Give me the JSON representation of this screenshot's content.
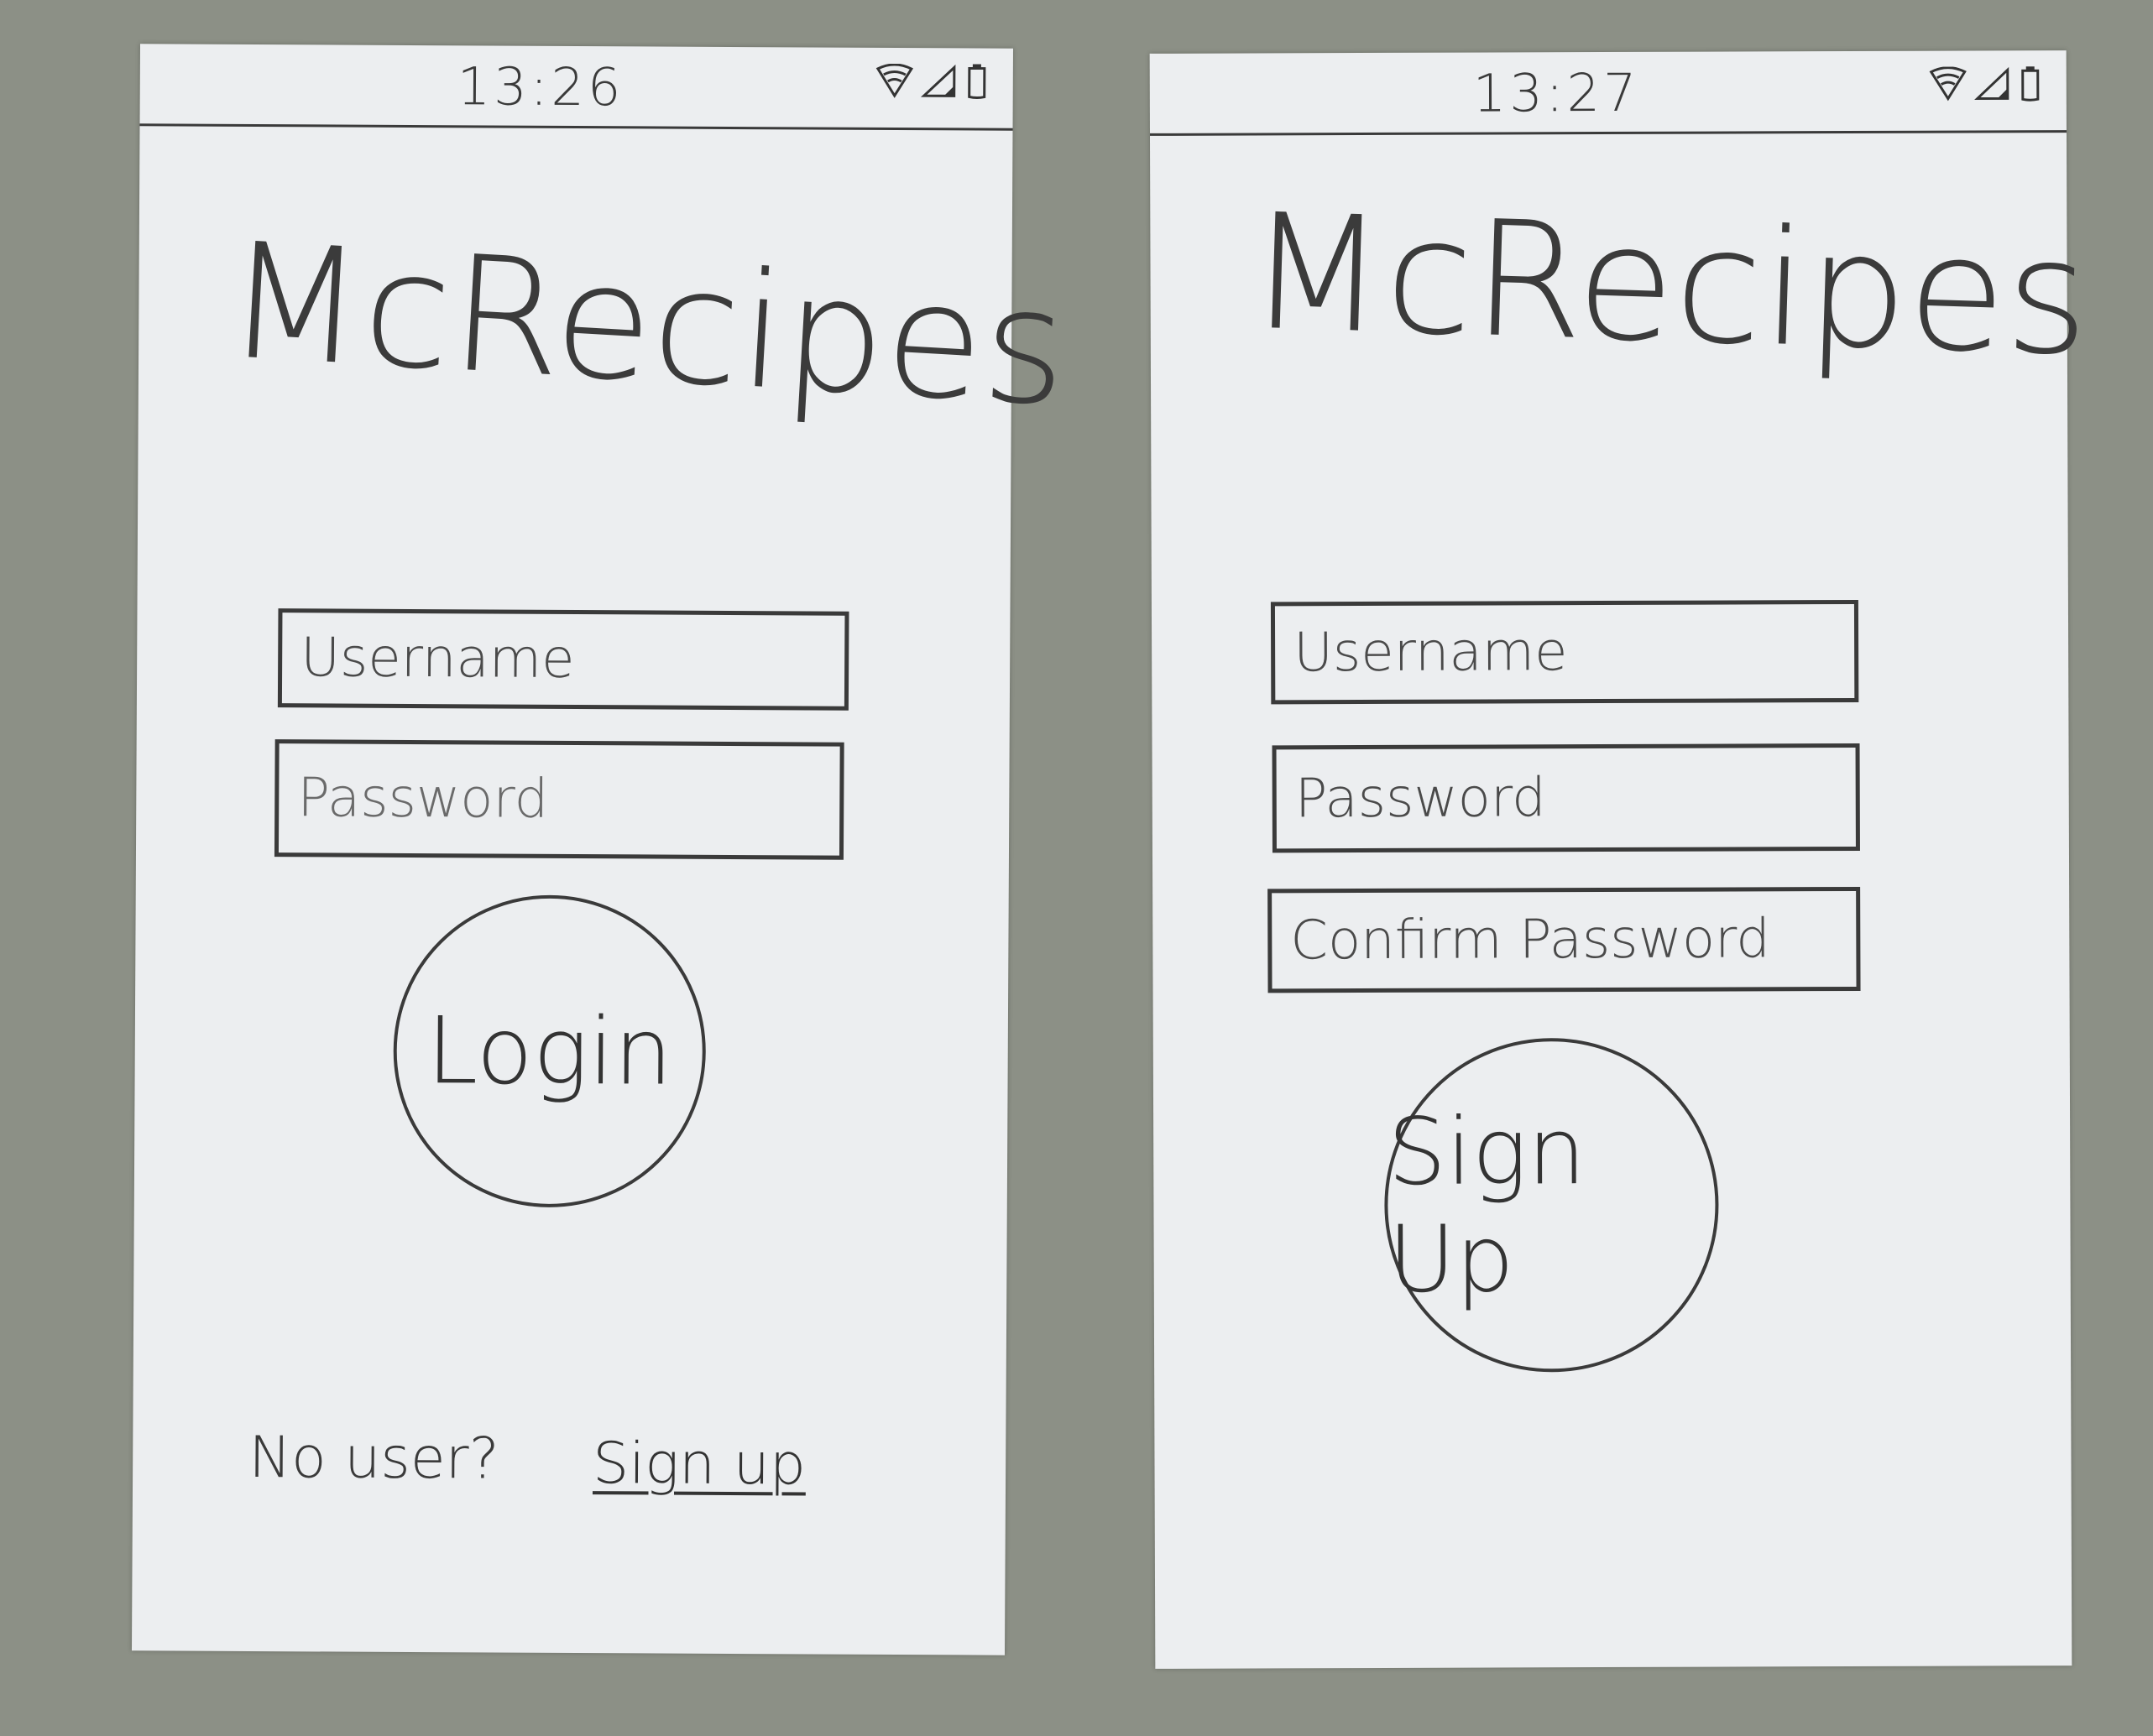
{
  "screens": {
    "login": {
      "status_time": "13:26",
      "app_title": "McRecipes",
      "username_placeholder": "Username",
      "password_placeholder": "Password",
      "login_label": "Login",
      "no_user_text": "No user?",
      "signup_link": "Sign up"
    },
    "signup": {
      "status_time": "13:27",
      "app_title": "McRecipes",
      "username_placeholder": "Username",
      "password_placeholder": "Password",
      "confirm_password_placeholder": "Confirm Password",
      "signup_label": "Sign Up"
    }
  },
  "status_icons": [
    "wifi-icon",
    "cellular-signal-icon",
    "battery-icon"
  ]
}
